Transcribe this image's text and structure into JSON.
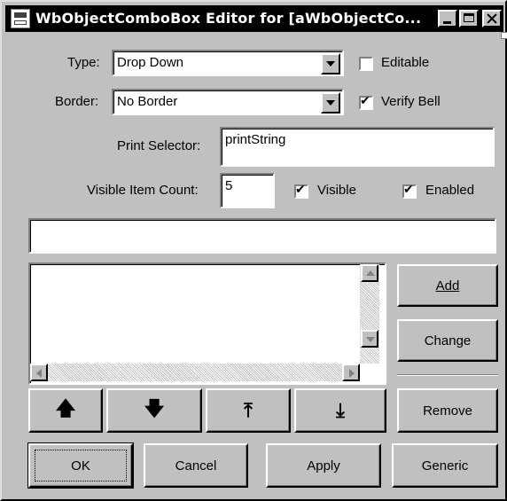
{
  "window": {
    "title": "WbObjectComboBox Editor for [aWbObjectCo...",
    "minimize": "minimize",
    "maximize": "maximize",
    "close": "close"
  },
  "type": {
    "label": "Type:",
    "value": "Drop Down"
  },
  "editable": {
    "label": "Editable",
    "checked": false
  },
  "border": {
    "label": "Border:",
    "value": "No Border"
  },
  "verify_bell": {
    "label": "Verify Bell",
    "checked": true
  },
  "print_selector": {
    "label": "Print Selector:",
    "value": "printString"
  },
  "visible_item_count": {
    "label": "Visible Item Count:",
    "value": "5"
  },
  "visible": {
    "label": "Visible",
    "checked": true
  },
  "enabled": {
    "label": "Enabled",
    "checked": true
  },
  "item_entry": {
    "value": ""
  },
  "list": {
    "items": []
  },
  "buttons": {
    "add": "Add",
    "change": "Change",
    "remove": "Remove",
    "ok": "OK",
    "cancel": "Cancel",
    "apply": "Apply",
    "generic": "Generic"
  },
  "move_buttons": {
    "up": "arrow-up-icon",
    "down": "arrow-down-icon",
    "top": "arrow-to-top-icon",
    "bottom": "arrow-to-bottom-icon"
  },
  "colors": {
    "face": "#c0c0c0",
    "title_bg": "#000000",
    "title_fg": "#ffffff",
    "field_bg": "#ffffff"
  }
}
